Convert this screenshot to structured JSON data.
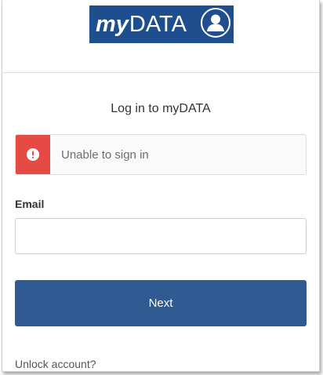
{
  "logo": {
    "prefix": "my",
    "suffix": "DATA",
    "avatar_icon": "user-icon"
  },
  "form": {
    "title": "Log in to myDATA",
    "alert": {
      "icon": "exclamation-icon",
      "message": "Unable to sign in"
    },
    "email_label": "Email",
    "email_value": "",
    "next_label": "Next",
    "unlock_link": "Unlock account?"
  },
  "colors": {
    "brand_blue": "#1f4e8f",
    "button_blue": "#305b92",
    "alert_red": "#e64a45"
  }
}
